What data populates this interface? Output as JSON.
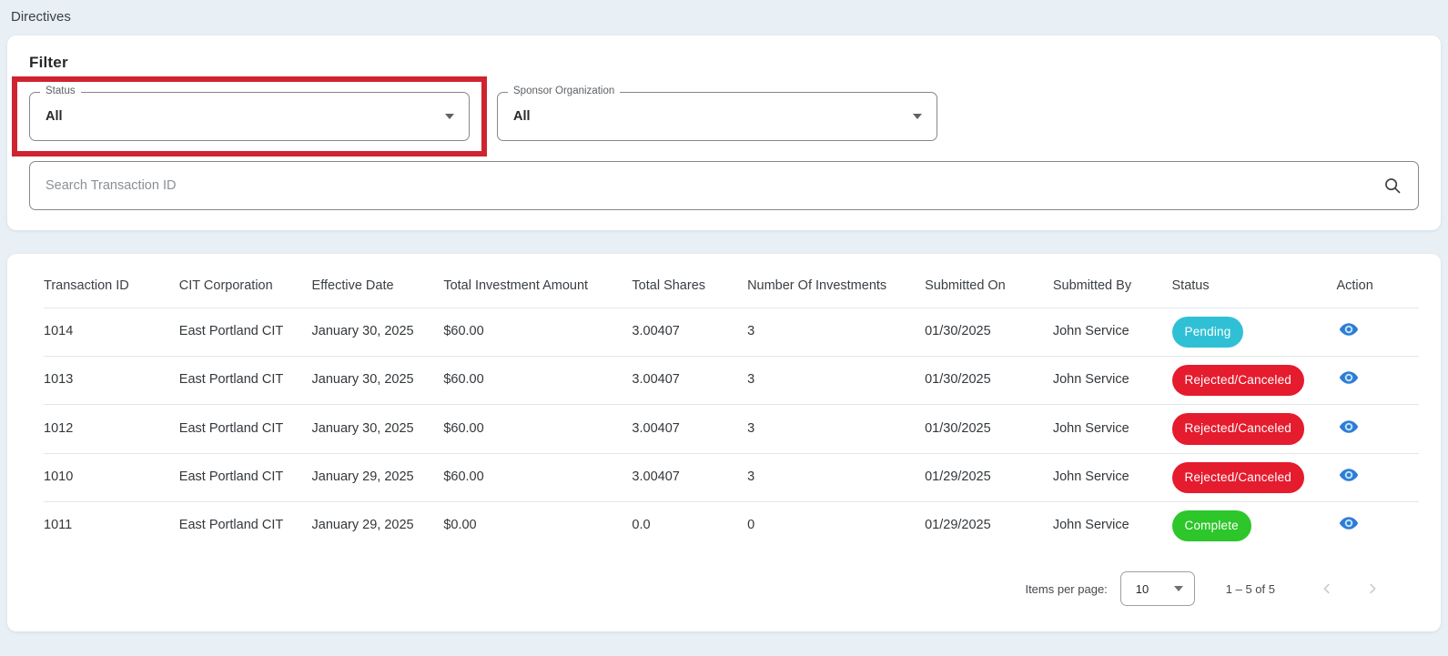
{
  "page": {
    "title": "Directives"
  },
  "filter": {
    "heading": "Filter",
    "status_select": {
      "label": "Status",
      "value": "All"
    },
    "sponsor_select": {
      "label": "Sponsor Organization",
      "value": "All"
    },
    "search_placeholder": "Search Transaction ID"
  },
  "table": {
    "columns": [
      {
        "key": "transaction_id",
        "label": "Transaction ID"
      },
      {
        "key": "cit_corporation",
        "label": "CIT Corporation"
      },
      {
        "key": "effective_date",
        "label": "Effective Date"
      },
      {
        "key": "total_investment_amount",
        "label": "Total Investment Amount"
      },
      {
        "key": "total_shares",
        "label": "Total Shares"
      },
      {
        "key": "number_of_investments",
        "label": "Number Of Investments"
      },
      {
        "key": "submitted_on",
        "label": "Submitted On"
      },
      {
        "key": "submitted_by",
        "label": "Submitted By"
      },
      {
        "key": "status",
        "label": "Status"
      },
      {
        "key": "action",
        "label": "Action"
      }
    ],
    "rows": [
      {
        "transaction_id": "1014",
        "cit_corporation": "East Portland CIT",
        "effective_date": "January 30, 2025",
        "total_investment_amount": "$60.00",
        "total_shares": "3.00407",
        "number_of_investments": "3",
        "submitted_on": "01/30/2025",
        "submitted_by": "John Service",
        "status": "Pending"
      },
      {
        "transaction_id": "1013",
        "cit_corporation": "East Portland CIT",
        "effective_date": "January 30, 2025",
        "total_investment_amount": "$60.00",
        "total_shares": "3.00407",
        "number_of_investments": "3",
        "submitted_on": "01/30/2025",
        "submitted_by": "John Service",
        "status": "Rejected/Canceled"
      },
      {
        "transaction_id": "1012",
        "cit_corporation": "East Portland CIT",
        "effective_date": "January 30, 2025",
        "total_investment_amount": "$60.00",
        "total_shares": "3.00407",
        "number_of_investments": "3",
        "submitted_on": "01/30/2025",
        "submitted_by": "John Service",
        "status": "Rejected/Canceled"
      },
      {
        "transaction_id": "1010",
        "cit_corporation": "East Portland CIT",
        "effective_date": "January 29, 2025",
        "total_investment_amount": "$60.00",
        "total_shares": "3.00407",
        "number_of_investments": "3",
        "submitted_on": "01/29/2025",
        "submitted_by": "John Service",
        "status": "Rejected/Canceled"
      },
      {
        "transaction_id": "1011",
        "cit_corporation": "East Portland CIT",
        "effective_date": "January 29, 2025",
        "total_investment_amount": "$0.00",
        "total_shares": "0.0",
        "number_of_investments": "0",
        "submitted_on": "01/29/2025",
        "submitted_by": "John Service",
        "status": "Complete"
      }
    ]
  },
  "pagination": {
    "items_per_page_label": "Items per page:",
    "items_per_page_value": "10",
    "range_label": "1 – 5 of 5"
  },
  "colors": {
    "annotation_red": "#cf2430",
    "status_pending": "#30c0d6",
    "status_rejected": "#e51b2e",
    "status_complete": "#2dc62b",
    "eye_blue": "#2e7cd6",
    "eye_iris": "#bfe6f7",
    "pager_disabled": "#c9ced2"
  }
}
